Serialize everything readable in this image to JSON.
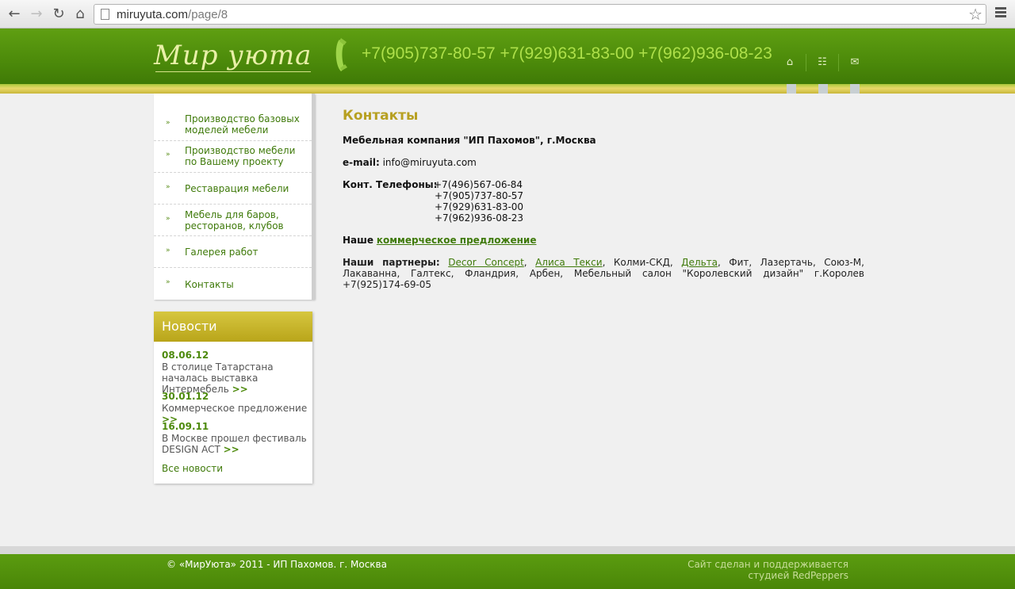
{
  "browser": {
    "url_host": "miruyuta.com",
    "url_path": "/page/8"
  },
  "header": {
    "logo_text": "Мир уюта",
    "phones": "+7(905)737-80-57 +7(929)631-83-00 +7(962)936-08-23",
    "icons": [
      "home-icon",
      "sitemap-icon",
      "mail-icon"
    ]
  },
  "sidebar": {
    "items": [
      {
        "label": "Производство базовых моделей мебели"
      },
      {
        "label": "Производство мебели по Вашему проекту"
      },
      {
        "label": "Реставрация мебели"
      },
      {
        "label": "Мебель для баров, ресторанов, клубов"
      },
      {
        "label": "Галерея работ"
      },
      {
        "label": "Контакты"
      }
    ]
  },
  "news": {
    "title": "Новости",
    "items": [
      {
        "date": "08.06.12",
        "text": "В столице Татарстана началась выставка Интермебель",
        "more": ">>"
      },
      {
        "date": "30.01.12",
        "text": "Коммерческое предложение",
        "more": ">>"
      },
      {
        "date": "16.09.11",
        "text": "В Москве прошел фестиваль DESIGN ACT",
        "more": ">>"
      }
    ],
    "all_link": "Все новости"
  },
  "main": {
    "title": "Контакты",
    "company": "Мебельная компания \"ИП Пахомов\", г.Москва",
    "email_label": "e-mail:",
    "email": "info@miruyuta.com",
    "phones_label": "Конт. Телефоны:",
    "phones": [
      "+7(496)567-06-84",
      "+7(905)737-80-57",
      "+7(929)631-83-00",
      "+7(962)936-08-23"
    ],
    "offer_prefix": "Наше",
    "offer_link": "коммерческое предложение",
    "partners_label": "Наши партнеры:",
    "partner_links": [
      "Decor Concept",
      "Алиса Текси",
      "Дельта"
    ],
    "partners_sep": ",",
    "partners_text_1": "Колми-СКД,",
    "partners_text_2": "Фит, Лазертачь, Союз-М, Лакаванна, Галтекс, Фландрия, Арбен, Мебельный салон \"Королевский дизайн\" г.Королев +7(925)174-69-05"
  },
  "footer": {
    "copyright": "© «МирУюта» 2011 - ИП Пахомов. г. Москва",
    "studio_line1": "Сайт сделан и поддерживается",
    "studio_line2": "студией RedPeppers"
  },
  "colors": {
    "header_green": "#4c8a0a",
    "link_green": "#3f7a0a",
    "title_gold": "#b7a021",
    "phones_green": "#aee04a"
  }
}
